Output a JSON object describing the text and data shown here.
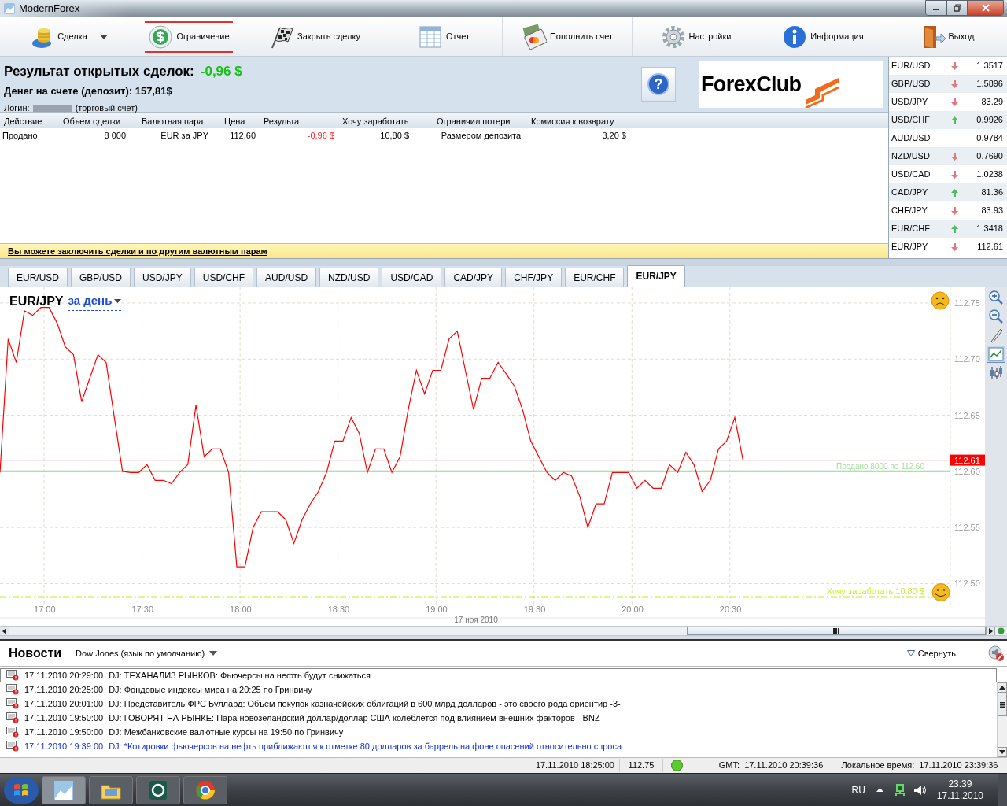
{
  "window": {
    "title": "ModernForex"
  },
  "toolbar": [
    {
      "label": "Сделка",
      "kind": "coins",
      "dropdown": true,
      "highlighted": false
    },
    {
      "label": "Ограничение",
      "kind": "dollar",
      "dropdown": false,
      "highlighted": true
    },
    {
      "label": "Закрыть сделку",
      "kind": "flag",
      "dropdown": false,
      "highlighted": false
    },
    {
      "label": "Отчет",
      "kind": "table",
      "dropdown": false,
      "highlighted": false
    },
    {
      "label": "Пополнить счет",
      "kind": "card",
      "dropdown": false,
      "highlighted": false
    },
    {
      "label": "Настройки",
      "kind": "gear",
      "dropdown": false,
      "highlighted": false
    },
    {
      "label": "Информация",
      "kind": "info",
      "dropdown": false,
      "highlighted": false
    },
    {
      "label": "Выход",
      "kind": "door",
      "dropdown": false,
      "highlighted": false
    }
  ],
  "account": {
    "result_label": "Результат открытых сделок:",
    "result_value": "-0,96 $",
    "deposit": "Денег на счете (депозит): 157,81$",
    "login_label": "Логин:",
    "login_suffix": "(торговый счет)",
    "help_button": "?",
    "logo": "ForexClub"
  },
  "trades_table": {
    "columns": [
      "Действие",
      "Объем сделки",
      "Валютная пара",
      "Цена",
      "Результат",
      "Хочу заработать",
      "Ограничил потери",
      "Комиссия к возврату"
    ],
    "rows": [
      [
        "Продано",
        "8 000",
        "EUR за JPY",
        "112,60",
        "-0,96 $",
        "10,80 $",
        "Размером депозита",
        "3,20 $"
      ]
    ]
  },
  "promo_link": "Вы можете заключить сделки и по другим валютным парам",
  "quotes": [
    {
      "pair": "EUR/USD",
      "rising": false,
      "falling": true,
      "value": "1.3517"
    },
    {
      "pair": "GBP/USD",
      "rising": false,
      "falling": true,
      "value": "1.5896"
    },
    {
      "pair": "USD/JPY",
      "rising": false,
      "falling": true,
      "value": "83.29"
    },
    {
      "pair": "USD/CHF",
      "rising": true,
      "falling": false,
      "value": "0.9926"
    },
    {
      "pair": "AUD/USD",
      "rising": false,
      "falling": false,
      "value": "0.9784"
    },
    {
      "pair": "NZD/USD",
      "rising": false,
      "falling": true,
      "value": "0.7690"
    },
    {
      "pair": "USD/CAD",
      "rising": false,
      "falling": true,
      "value": "1.0238"
    },
    {
      "pair": "CAD/JPY",
      "rising": true,
      "falling": false,
      "value": "81.36"
    },
    {
      "pair": "CHF/JPY",
      "rising": false,
      "falling": true,
      "value": "83.93"
    },
    {
      "pair": "EUR/CHF",
      "rising": true,
      "falling": false,
      "value": "1.3418"
    },
    {
      "pair": "EUR/JPY",
      "rising": false,
      "falling": true,
      "value": "112.61"
    }
  ],
  "pair_tabs": [
    {
      "label": "EUR/USD",
      "selected": false
    },
    {
      "label": "GBP/USD",
      "selected": false
    },
    {
      "label": "USD/JPY",
      "selected": false
    },
    {
      "label": "USD/CHF",
      "selected": false
    },
    {
      "label": "AUD/USD",
      "selected": false
    },
    {
      "label": "NZD/USD",
      "selected": false
    },
    {
      "label": "USD/CAD",
      "selected": false
    },
    {
      "label": "CAD/JPY",
      "selected": false
    },
    {
      "label": "CHF/JPY",
      "selected": false
    },
    {
      "label": "EUR/CHF",
      "selected": false
    },
    {
      "label": "EUR/JPY",
      "selected": true
    }
  ],
  "chart": {
    "period": "за день",
    "tools": [
      {
        "kind": "zoom-in",
        "selected": false
      },
      {
        "kind": "zoom-out",
        "selected": false
      },
      {
        "kind": "pencil",
        "selected": false
      },
      {
        "kind": "line",
        "selected": true
      },
      {
        "kind": "candles",
        "selected": false
      }
    ],
    "chart_data": {
      "type": "line",
      "title": "EUR/JPY",
      "grid": true,
      "xlabel": "17 ноя 2010",
      "xlim": [
        16.775,
        21.625
      ],
      "ylim": [
        112.487,
        112.764
      ],
      "x": [
        16.775,
        16.8167,
        16.8583,
        16.9,
        16.9417,
        16.9833,
        17.025,
        17.0667,
        17.1083,
        17.15,
        17.1917,
        17.2333,
        17.275,
        17.3167,
        17.3583,
        17.4,
        17.4417,
        17.4833,
        17.525,
        17.5667,
        17.6083,
        17.65,
        17.6917,
        17.7333,
        17.775,
        17.8167,
        17.8583,
        17.9,
        17.9417,
        17.9833,
        18.025,
        18.0667,
        18.1083,
        18.15,
        18.1917,
        18.2333,
        18.275,
        18.3167,
        18.3583,
        18.4,
        18.4417,
        18.4833,
        18.525,
        18.5667,
        18.6083,
        18.65,
        18.6917,
        18.7333,
        18.775,
        18.8167,
        18.8583,
        18.9,
        18.9417,
        18.9833,
        19.025,
        19.0667,
        19.1083,
        19.15,
        19.1917,
        19.2333,
        19.275,
        19.3167,
        19.3583,
        19.4,
        19.4417,
        19.4833,
        19.525,
        19.5667,
        19.6083,
        19.65,
        19.6917,
        19.7333,
        19.775,
        19.8167,
        19.8583,
        19.9,
        19.9417,
        19.9833,
        20.025,
        20.0667,
        20.1083,
        20.15,
        20.1917,
        20.2333,
        20.275,
        20.3167,
        20.3583,
        20.4,
        20.4417,
        20.4833,
        20.525,
        20.5667
      ],
      "series": [
        {
          "color": "#ff0000",
          "values": [
            112.599,
            112.718,
            112.697,
            112.743,
            112.739,
            112.746,
            112.746,
            112.732,
            112.711,
            112.704,
            112.662,
            112.683,
            112.704,
            112.697,
            112.648,
            112.6,
            112.599,
            112.599,
            112.606,
            112.592,
            112.592,
            112.589,
            112.599,
            112.606,
            112.659,
            112.613,
            112.62,
            112.62,
            112.599,
            112.515,
            112.515,
            112.55,
            112.564,
            112.564,
            112.564,
            112.557,
            112.536,
            112.557,
            112.571,
            112.582,
            112.599,
            112.627,
            112.627,
            112.648,
            112.634,
            112.599,
            112.62,
            112.62,
            112.599,
            112.613,
            112.655,
            112.69,
            112.669,
            112.69,
            112.69,
            112.718,
            112.725,
            112.69,
            112.655,
            112.683,
            112.683,
            112.697,
            112.687,
            112.676,
            112.655,
            112.627,
            112.613,
            112.599,
            112.592,
            112.599,
            112.596,
            112.578,
            112.55,
            112.571,
            112.571,
            112.599,
            112.599,
            112.599,
            112.585,
            112.592,
            112.585,
            112.585,
            112.606,
            112.599,
            112.617,
            112.606,
            112.582,
            112.592,
            112.62,
            112.627,
            112.648,
            112.61
          ]
        }
      ],
      "xticks": [
        {
          "value": 17,
          "label": "17:00"
        },
        {
          "value": 17.5,
          "label": "17:30"
        },
        {
          "value": 18,
          "label": "18:00"
        },
        {
          "value": 18.5,
          "label": "18:30"
        },
        {
          "value": 19,
          "label": "19:00"
        },
        {
          "value": 19.5,
          "label": "19:30"
        },
        {
          "value": 20,
          "label": "20:00"
        },
        {
          "value": 20.5,
          "label": "20:30"
        }
      ],
      "yticks": [
        {
          "value": 112.5,
          "label": "112.50"
        },
        {
          "value": 112.55,
          "label": "112.55"
        },
        {
          "value": 112.6,
          "label": "112.60"
        },
        {
          "value": 112.65,
          "label": "112.65"
        },
        {
          "value": 112.7,
          "label": "112.70"
        },
        {
          "value": 112.75,
          "label": "112.75"
        }
      ],
      "ref_lines": [
        {
          "axis": "y",
          "value": 112.61,
          "label": "112.61"
        },
        {
          "axis": "y",
          "value": 112.6,
          "label": "Продано 8000 по 112.60"
        },
        {
          "axis": "y",
          "value": 112.488,
          "label": "Хочу заработать 10.80 $"
        }
      ]
    }
  },
  "news": {
    "title": "Новости",
    "source": "Dow Jones (язык по умолчанию)",
    "collapse": "Свернуть",
    "items": [
      {
        "time": "17.11.2010 20:29:00",
        "text": "DJ: ТЕХАНАЛИЗ РЫНКОВ: Фьючерсы на нефть будут снижаться",
        "selected": true,
        "unread": false
      },
      {
        "time": "17.11.2010 20:25:00",
        "text": "DJ: Фондовые индексы мира на 20:25 по Гринвичу",
        "selected": false,
        "unread": false
      },
      {
        "time": "17.11.2010 20:01:00",
        "text": "DJ: Представитель ФРС Буллард: Объем покупок казначейских облигаций в 600 млрд долларов - это своего рода ориентир -3-",
        "selected": false,
        "unread": false
      },
      {
        "time": "17.11.2010 19:50:00",
        "text": "DJ: ГОВОРЯТ НА РЫНКЕ: Пара новозеландский доллар/доллар США колеблется под влиянием внешних факторов - BNZ",
        "selected": false,
        "unread": false
      },
      {
        "time": "17.11.2010 19:50:00",
        "text": "DJ: Межбанковские валютные курсы на 19:50 по Гринвичу",
        "selected": false,
        "unread": false
      },
      {
        "time": "17.11.2010 19:39:00",
        "text": "DJ: *Котировки фьючерсов на нефть приближаются к отметке 80 долларов за баррель на фоне опасений относительно спроса",
        "selected": false,
        "unread": true
      }
    ]
  },
  "status_bar": {
    "quote_time": "17.11.2010 18:25:00",
    "price": "112.75",
    "connected": true,
    "gmt": "GMT:  17.11.2010 20:39:36",
    "local": "Локальное время:  17.11.2010 23:39:36"
  },
  "taskbar": {
    "language": "RU",
    "clock_time": "23:39",
    "clock_date": "17.11.2010"
  }
}
